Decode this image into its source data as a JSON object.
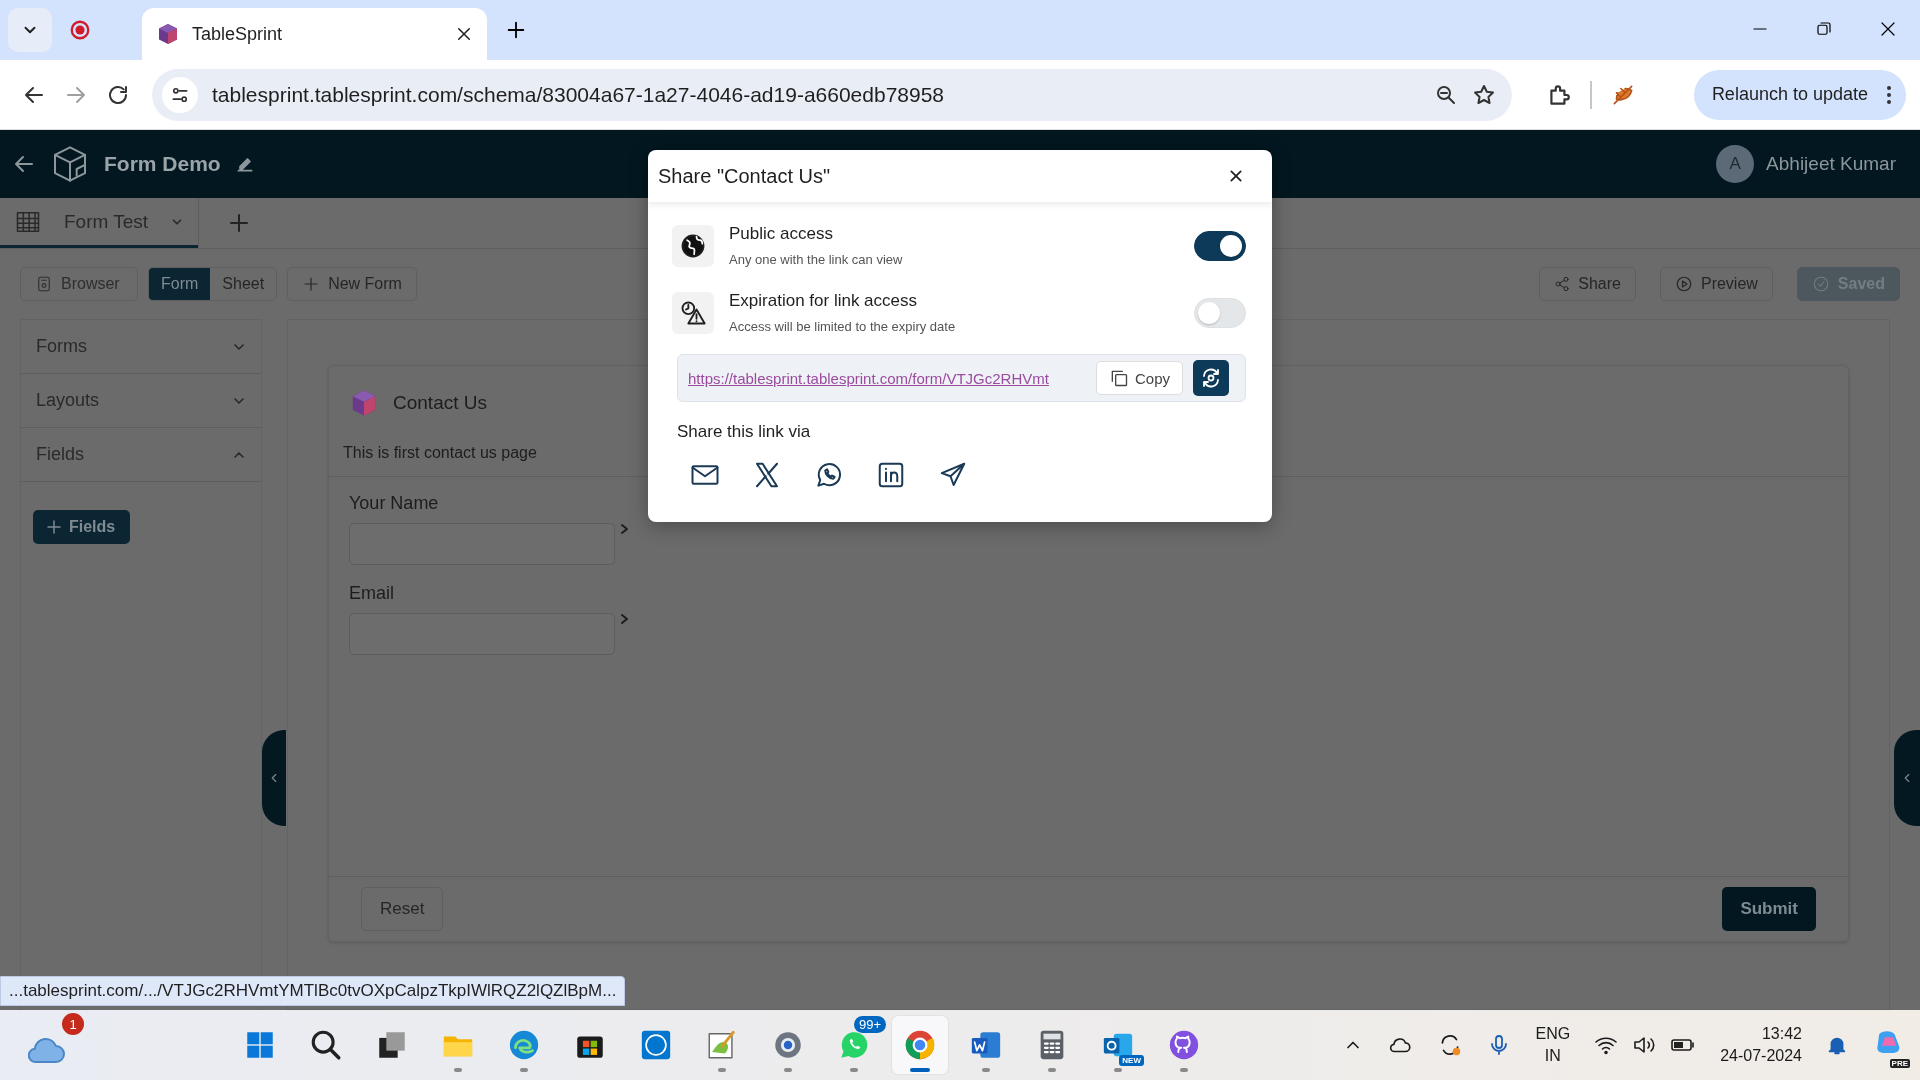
{
  "browser": {
    "tab_title": "TableSprint",
    "url": "tablesprint.tablesprint.com/schema/83004a67-1a27-4046-ad19-a660edb78958",
    "update_button": "Relaunch to update"
  },
  "app_header": {
    "title": "Form Demo",
    "user_initial": "A",
    "user_name": "Abhijeet Kumar"
  },
  "sheet_tabs": [
    {
      "label": "Form Test",
      "selected": true
    }
  ],
  "toolbar": {
    "browser_button": "Browser",
    "view_toggle": [
      {
        "label": "Form",
        "selected": true
      },
      {
        "label": "Sheet",
        "selected": false
      }
    ],
    "new_form_button": "New Form",
    "share_button": "Share",
    "preview_button": "Preview",
    "saved_button": "Saved"
  },
  "sidebar": {
    "sections": [
      {
        "label": "Forms",
        "expanded": false
      },
      {
        "label": "Layouts",
        "expanded": false
      },
      {
        "label": "Fields",
        "expanded": true
      }
    ],
    "add_button": "Fields"
  },
  "form": {
    "title": "Contact Us",
    "description": "This is first contact us page",
    "fields": [
      {
        "label": "Your Name"
      },
      {
        "label": "Email"
      }
    ],
    "reset_button": "Reset",
    "submit_button": "Submit"
  },
  "modal": {
    "title": "Share \"Contact Us\"",
    "options": [
      {
        "kind": "public",
        "title": "Public access",
        "subtitle": "Any one with the link can view",
        "on": true
      },
      {
        "kind": "expiry",
        "title": "Expiration for link access",
        "subtitle": "Access will be limited to the expiry date",
        "on": false
      }
    ],
    "link": "https://tablesprint.tablesprint.com/form/VTJGc2RHVmt",
    "copy_button": "Copy",
    "share_via": "Share this link via",
    "share_targets": [
      {
        "kind": "email"
      },
      {
        "kind": "x"
      },
      {
        "kind": "whatsapp"
      },
      {
        "kind": "linkedin"
      },
      {
        "kind": "telegram"
      }
    ]
  },
  "status_url": "...tablesprint.com/.../VTJGc2RHVmtYMTlBc0tvOXpCalpzTkpIWlRQZ2lQZlBpM...",
  "taskbar": {
    "weather_badge": "1",
    "apps": [
      {
        "kind": "start",
        "running": false,
        "selected": false
      },
      {
        "kind": "search",
        "running": false,
        "selected": false
      },
      {
        "kind": "taskview",
        "running": false,
        "selected": false
      },
      {
        "kind": "explorer",
        "running": true,
        "selected": false
      },
      {
        "kind": "edge",
        "running": true,
        "selected": false
      },
      {
        "kind": "store",
        "running": false,
        "selected": false
      },
      {
        "kind": "dell",
        "running": false,
        "selected": false
      },
      {
        "kind": "paint",
        "running": true,
        "selected": false
      },
      {
        "kind": "settings",
        "running": true,
        "selected": false
      },
      {
        "kind": "whatsapp",
        "running": true,
        "selected": false,
        "badge": "99+"
      },
      {
        "kind": "chrome",
        "running": true,
        "selected": true
      },
      {
        "kind": "word",
        "running": true,
        "selected": false
      },
      {
        "kind": "calculator",
        "running": true,
        "selected": false
      },
      {
        "kind": "outlook",
        "running": true,
        "selected": false,
        "badge": "NEW"
      },
      {
        "kind": "github",
        "running": true,
        "selected": false
      }
    ],
    "language": "ENG",
    "region": "IN",
    "time": "13:42",
    "date": "24-07-2024",
    "copilot_badge": "PRE"
  }
}
